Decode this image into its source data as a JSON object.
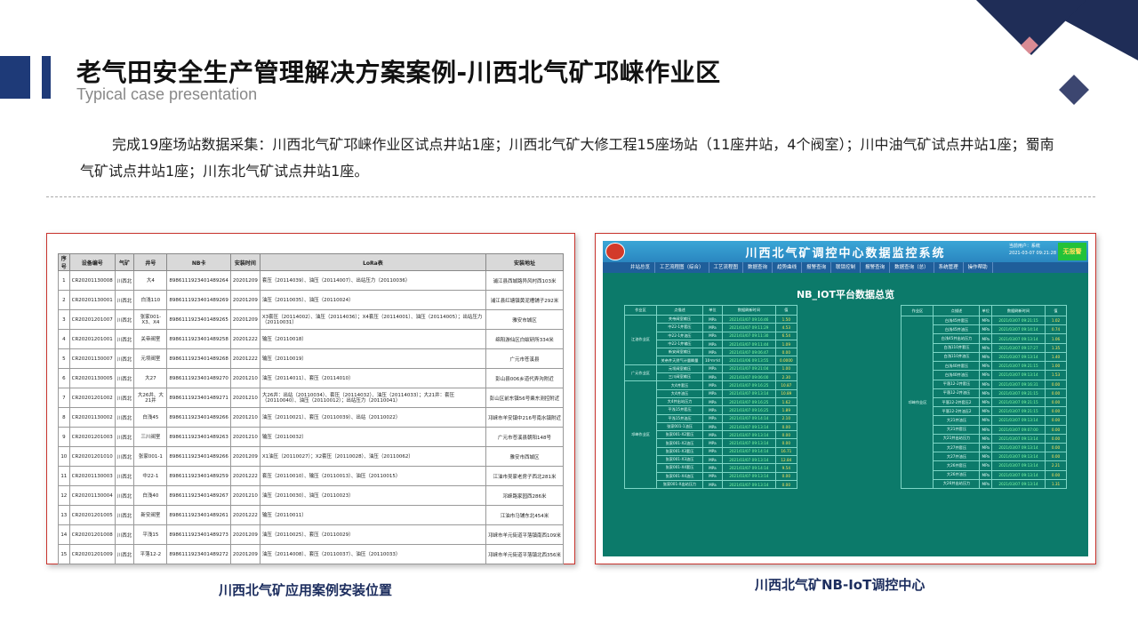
{
  "header": {
    "title": "老气田安全生产管理解决方案案例-川西北气矿邛崃作业区",
    "subtitle": "Typical case presentation"
  },
  "description": "完成19座场站数据采集：川西北气矿邛崃作业区试点井站1座；川西北气矿大修工程15座场站（11座井站，4个阀室）；川中油气矿试点井站1座；蜀南气矿试点井站1座；川东北气矿试点井站1座。",
  "left_panel": {
    "caption": "川西北气矿应用案例安装位置",
    "columns": [
      "序号",
      "设备编号",
      "气矿",
      "井号",
      "NB卡",
      "安装时间",
      "LoRa表",
      "安装地址"
    ],
    "rows": [
      [
        "1",
        "CR20201130008",
        "川西北",
        "大4",
        "8986111923401489264",
        "20201209",
        "套压（20114039）、油压（20114007）、出站压力（20110036）",
        "浦江县西城路异风村西103米"
      ],
      [
        "2",
        "CR20201130001",
        "川西北",
        "白浅110",
        "8986111923401489269",
        "20201209",
        "油压（20110035）、油压（20110024）",
        "浦江县红塘镇黄泥槽铺子292米"
      ],
      [
        "3",
        "CR20201201007",
        "川西北",
        "张家001-X3、X4",
        "8986111923401489265",
        "20201209",
        "X3套压（20114002）、油压（20114036）；X4套压（20114001）、油压（20114005）；出站压力（20110031）",
        "雅安市城区"
      ],
      [
        "4",
        "CR20201201001",
        "川西北",
        "关帝阀室",
        "8986111923401489258",
        "20201222",
        "输压（20110018）",
        "绵阳游仙区白蚁研所334米"
      ],
      [
        "5",
        "CR20201130007",
        "川西北",
        "元坝阀室",
        "8986111923401489268",
        "20201222",
        "输压（20110019）",
        "广元市苍溪县"
      ],
      [
        "6",
        "CR20201130005",
        "川西北",
        "大27",
        "8986111923401489270",
        "20201210",
        "油压（20114011）、套压（20114010）",
        "彭山县006乡道代弄沟附近"
      ],
      [
        "7",
        "CR20201201002",
        "川西北",
        "大26井、大21井",
        "8986111923401489271",
        "20201210",
        "大26井：出站（20110034）、套压（20114032）、油压（20114033）；大21井：套压（20110040）、油压（20110012）；出站压力（20110041）",
        "彭山区前东镇56号乘东测控附近"
      ],
      [
        "8",
        "CR20201130002",
        "川西北",
        "白浅45",
        "8986111923401489266",
        "20201210",
        "油压（20110021）、套压（20110039）、出站（20110022）",
        "邛崃市羊安镇中216号南水镇附近"
      ],
      [
        "9",
        "CR20201201003",
        "川西北",
        "三川阀室",
        "8986111923401489263",
        "20201210",
        "输压（20110032）",
        "广元市苍溪县朝阳148号"
      ],
      [
        "10",
        "CR20201201010",
        "川西北",
        "张家001-1",
        "8986111923401489266",
        "20201209",
        "X1油压（20110027）；X2套压（20110028）、油压（20110062）",
        "雅安市西城区"
      ],
      [
        "11",
        "CR20201130003",
        "川西北",
        "中22-1",
        "8986111923401489259",
        "20201222",
        "套压（20110010）、输压（20110013）、油压（20110015）",
        "江油市吴家老房子西北281米"
      ],
      [
        "12",
        "CR20201130004",
        "川西北",
        "白浅40",
        "8986111923401489267",
        "20201210",
        "油压（20110030）、油压（20110023）",
        "邛崃路家园西286米"
      ],
      [
        "13",
        "CR20201201005",
        "川西北",
        "新安阀室",
        "8986111923401489261",
        "20201222",
        "输压（20110011）",
        "江油市马铺东北454米"
      ],
      [
        "14",
        "CR20201201008",
        "川西北",
        "平浅15",
        "8986111923401489273",
        "20201209",
        "油压（20110025）、套压（20110029）",
        "邛崃市羊元街道平落镇南西109米"
      ],
      [
        "15",
        "CR20201201009",
        "川西北",
        "平落12-2",
        "8986111923401489272",
        "20201209",
        "油压（20114008）、套压（20110037）、油压（20110033）",
        "邛崃市羊元街道平落镇北西356米"
      ]
    ]
  },
  "right_panel": {
    "caption": "川西北气矿NB-IoT调控中心",
    "screen": {
      "title": "川西北气矿调控中心数据监控系统",
      "user": "当前用户：系统",
      "datetime": "2021-03-07 09:21:28",
      "alarm": "无报警",
      "nav": [
        "井站总览",
        "工艺流程图（综合）",
        "工艺流程图",
        "数据查询",
        "趋势曲线",
        "报警查询",
        "联锁控制",
        "报警查询",
        "数据查询（总）",
        "系统管理",
        "操作帮助"
      ],
      "subtitle": "NB_IOT平台数据总览",
      "table_headers": [
        "作业区",
        "点描述",
        "单位",
        "数据刷新时间",
        "值"
      ],
      "left_table": [
        {
          "area": "江油作业区",
          "rows": [
            [
              "关帝阀室输压",
              "MPa",
              "2021/03/07 09:16:46",
              "1.50"
            ],
            [
              "中22-1井套压",
              "MPa",
              "2021/03/07 09:11:29",
              "4.53"
            ],
            [
              "中22-1井油压",
              "MPa",
              "2021/03/07 09:11:30",
              "6.54"
            ],
            [
              "中22-1井输压",
              "MPa",
              "2021/03/07 09:11:44",
              "1.09"
            ],
            [
              "新安阀室输压",
              "MPa",
              "2021/03/07 09:06:47",
              "0.00"
            ],
            [
              "关帝井天然气计量瞬量",
              "10⁴m³/d",
              "2021/03/06 09:13:55",
              "0.0000"
            ]
          ]
        },
        {
          "area": "广元作业区",
          "rows": [
            [
              "元坝阀室输压",
              "MPa",
              "2021/03/07 09:21:04",
              "1.00"
            ],
            [
              "三川阀室输压",
              "MPa",
              "2021/03/07 09:06:00",
              "2.30"
            ]
          ]
        },
        {
          "area": "邛崃作业区",
          "rows": [
            [
              "大4井套压",
              "MPa",
              "2021/03/07 09:16:25",
              "10.87"
            ],
            [
              "大4井油压",
              "MPa",
              "2021/03/07 09:13:14",
              "10.89"
            ],
            [
              "大4井出站压力",
              "MPa",
              "2021/03/07 09:16:25",
              "1.62"
            ],
            [
              "平浅15井套压",
              "MPa",
              "2021/03/07 09:16:25",
              "1.89"
            ],
            [
              "平浅15井油压",
              "MPa",
              "2021/03/07 09:14:14",
              "2.10"
            ],
            [
              "张家001-1油压",
              "MPa",
              "2021/03/07 09:13:14",
              "0.00"
            ],
            [
              "张家001-X2套压",
              "MPa",
              "2021/03/07 09:13:14",
              "0.00"
            ],
            [
              "张家001-X2油压",
              "MPa",
              "2021/03/07 09:13:14",
              "0.00"
            ],
            [
              "张家001-X3套压",
              "MPa",
              "2021/03/07 09:14:14",
              "16.71"
            ],
            [
              "张家001-X3油压",
              "MPa",
              "2021/03/07 09:13:14",
              "12.84"
            ],
            [
              "张家001-X4套压",
              "MPa",
              "2021/03/07 09:14:14",
              "9.54"
            ],
            [
              "张家001-X4油压",
              "MPa",
              "2021/03/07 09:13:14",
              "0.00"
            ],
            [
              "张家001-X出站压力",
              "MPa",
              "2021/03/07 09:13:14",
              "0.00"
            ]
          ]
        }
      ],
      "right_table": [
        {
          "area": "邛崃作业区",
          "rows": [
            [
              "白浅45井套压",
              "MPa",
              "2021/03/07 09:21:15",
              "1.02"
            ],
            [
              "白浅45井油压",
              "MPa",
              "2021/03/07 09:14:14",
              "0.74"
            ],
            [
              "白浅45井出站压力",
              "MPa",
              "2021/03/07 09:13:14",
              "1.06"
            ],
            [
              "白浅110井套压",
              "MPa",
              "2021/03/07 09:17:27",
              "1.35"
            ],
            [
              "白浅110井油压",
              "MPa",
              "2021/03/07 09:13:14",
              "1.40"
            ],
            [
              "白浅40井套压",
              "MPa",
              "2021/03/07 09:21:15",
              "1.00"
            ],
            [
              "白浅40井油压",
              "MPa",
              "2021/03/07 09:13:14",
              "1.53"
            ],
            [
              "平落12-2井套压",
              "MPa",
              "2021/03/07 09:16:31",
              "0.00"
            ],
            [
              "平落12-2井油压",
              "MPa",
              "2021/03/07 09:21:15",
              "0.00"
            ],
            [
              "平落12-2井套压2",
              "MPa",
              "2021/03/07 09:21:15",
              "0.00"
            ],
            [
              "平落12-2井油压2",
              "MPa",
              "2021/03/07 09:21:15",
              "0.00"
            ],
            [
              "大21井油压",
              "MPa",
              "2021/03/07 09:13:14",
              "0.00"
            ],
            [
              "大21井套压",
              "MPa",
              "2021/03/07 09:07:00",
              "0.00"
            ],
            [
              "大21井出站压力",
              "MPa",
              "2021/03/07 09:13:14",
              "0.00"
            ],
            [
              "大27井套压",
              "MPa",
              "2021/03/07 09:13:14",
              "0.00"
            ],
            [
              "大27井油压",
              "MPa",
              "2021/03/07 09:13:14",
              "0.00"
            ],
            [
              "大26井套压",
              "MPa",
              "2021/03/07 09:13:14",
              "2.21"
            ],
            [
              "大26井油压",
              "MPa",
              "2021/03/07 09:13:14",
              "0.00"
            ],
            [
              "大26井出站压力",
              "MPa",
              "2021/03/07 09:13:14",
              "1.31"
            ]
          ]
        }
      ]
    }
  }
}
